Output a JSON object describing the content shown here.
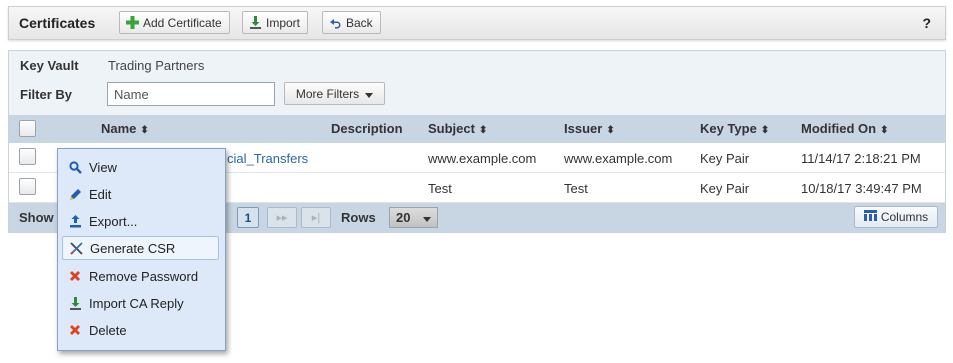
{
  "toolbar": {
    "title": "Certificates",
    "buttons": [
      {
        "label": "Add Certificate",
        "icon": "plus-icon"
      },
      {
        "label": "Import",
        "icon": "import-icon"
      },
      {
        "label": "Back",
        "icon": "back-arrow-icon"
      }
    ],
    "help": "?"
  },
  "filters": {
    "key_vault_label": "Key Vault",
    "key_vault_value": "Trading Partners",
    "filter_by_label": "Filter By",
    "name_placeholder": "Name",
    "more_filters_label": "More Filters"
  },
  "table": {
    "columns": [
      "Name",
      "Description",
      "Subject",
      "Issuer",
      "Key Type",
      "Modified On"
    ],
    "rows": [
      {
        "name": "cial_Transfers",
        "description": "",
        "subject": "www.example.com",
        "issuer": "www.example.com",
        "key_type": "Key Pair",
        "modified_on": "11/14/17 2:18:21 PM"
      },
      {
        "name": "",
        "description": "",
        "subject": "Test",
        "issuer": "Test",
        "key_type": "Key Pair",
        "modified_on": "10/18/17 3:49:47 PM"
      }
    ]
  },
  "footer": {
    "show_label": "Show",
    "current_page": "1",
    "next": "▸▸",
    "last": "▸|",
    "rows_label": "Rows",
    "rows_value": "20",
    "columns_label": "Columns"
  },
  "context_menu": {
    "items": [
      {
        "label": "View",
        "icon": "magnifier-icon"
      },
      {
        "label": "Edit",
        "icon": "pencil-icon"
      },
      {
        "label": "Export...",
        "icon": "export-icon"
      },
      {
        "label": "Generate CSR",
        "icon": "tools-icon"
      },
      {
        "label": "Remove Password",
        "icon": "red-x-icon"
      },
      {
        "label": "Import CA Reply",
        "icon": "import-icon"
      },
      {
        "label": "Delete",
        "icon": "red-x-icon"
      }
    ]
  },
  "colors": {
    "accent_link": "#2a66a8",
    "header_bg": "#c8d6e4",
    "filter_bg": "#eef3f8",
    "menu_bg": "#dde9f8",
    "delete_red": "#e0401e",
    "add_green": "#3aa33a"
  }
}
